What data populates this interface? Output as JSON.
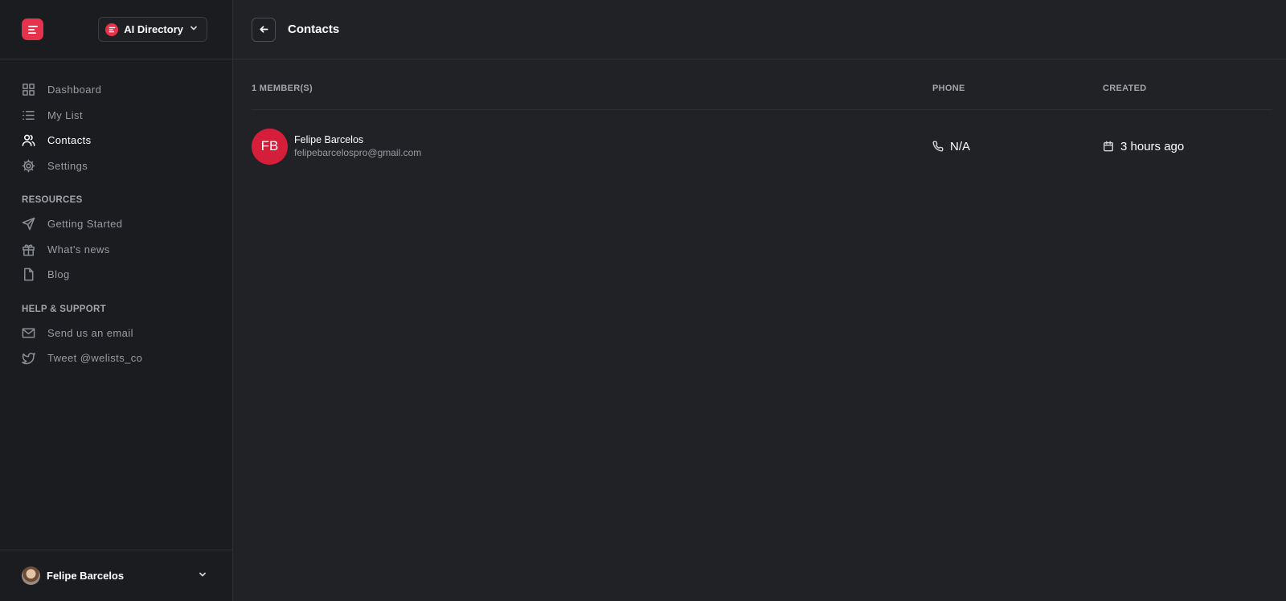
{
  "sidebar": {
    "workspace": {
      "name": "AI Directory"
    },
    "nav": [
      {
        "label": "Dashboard",
        "icon": "grid-icon",
        "active": false
      },
      {
        "label": "My List",
        "icon": "list-icon",
        "active": false
      },
      {
        "label": "Contacts",
        "icon": "users-icon",
        "active": true
      },
      {
        "label": "Settings",
        "icon": "gear-icon",
        "active": false
      }
    ],
    "resources": {
      "title": "RESOURCES",
      "items": [
        {
          "label": "Getting Started",
          "icon": "send-icon"
        },
        {
          "label": "What's news",
          "icon": "gift-icon"
        },
        {
          "label": "Blog",
          "icon": "file-icon"
        }
      ]
    },
    "support": {
      "title": "HELP & SUPPORT",
      "items": [
        {
          "label": "Send us an email",
          "icon": "mail-icon"
        },
        {
          "label": "Tweet @welists_co",
          "icon": "twitter-icon"
        }
      ]
    },
    "user": {
      "name": "Felipe Barcelos"
    }
  },
  "header": {
    "title": "Contacts"
  },
  "table": {
    "columns": {
      "member": "1 MEMBER(S)",
      "phone": "PHONE",
      "created": "CREATED"
    },
    "rows": [
      {
        "initials": "FB",
        "name": "Felipe Barcelos",
        "email": "felipebarcelospro@gmail.com",
        "phone": "N/A",
        "created": "3 hours ago"
      }
    ]
  },
  "colors": {
    "accent": "#e6324a",
    "avatar": "#d51f3a",
    "background": "#202226",
    "sidebar": "#1a1c1f"
  }
}
